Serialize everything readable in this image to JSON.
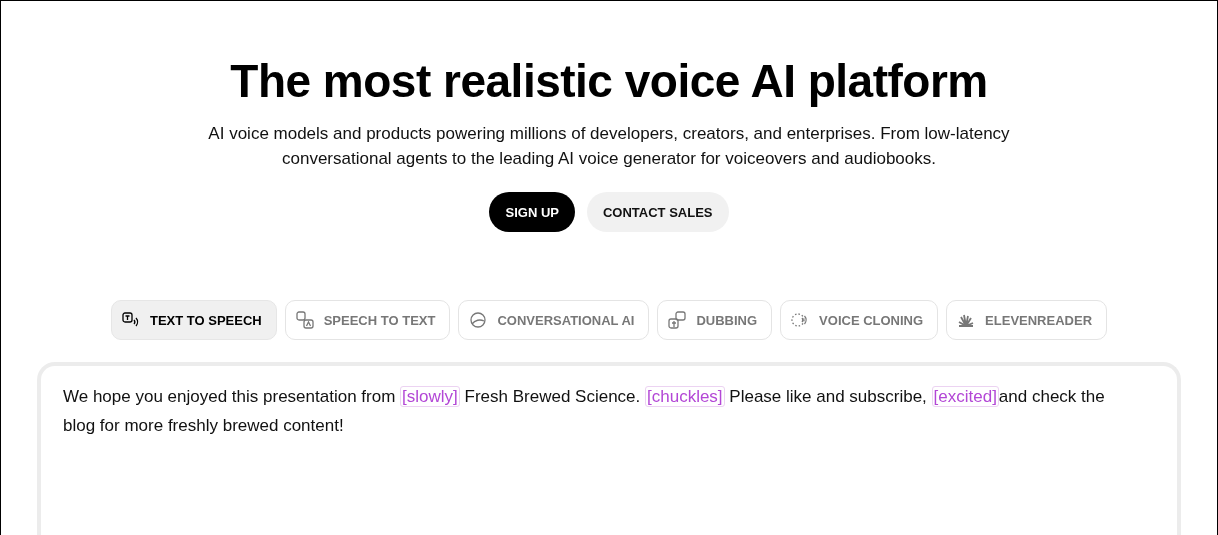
{
  "hero": {
    "title": "The most realistic voice AI platform",
    "subtitle": "AI voice models and products powering millions of developers, creators, and enterprises. From low-latency conversational agents to the leading AI voice generator for voiceovers and audiobooks."
  },
  "buttons": [
    {
      "label": "SIGN UP",
      "kind": "primary"
    },
    {
      "label": "CONTACT SALES",
      "kind": "secondary"
    }
  ],
  "tabs": [
    {
      "label": "TEXT TO SPEECH",
      "kind": "tts",
      "selected": true
    },
    {
      "label": "SPEECH TO TEXT",
      "kind": "stt",
      "selected": false
    },
    {
      "label": "CONVERSATIONAL AI",
      "kind": "chat",
      "selected": false
    },
    {
      "label": "DUBBING",
      "kind": "dub",
      "selected": false
    },
    {
      "label": "VOICE CLONING",
      "kind": "clone",
      "selected": false
    },
    {
      "label": "ELEVENREADER",
      "kind": "reader",
      "selected": false
    }
  ],
  "editor": {
    "segments": [
      {
        "kind": "plain",
        "text": "We hope you enjoyed this presentation from "
      },
      {
        "kind": "tag",
        "text": "[slowly]"
      },
      {
        "kind": "plain",
        "text": " Fresh Brewed Science. "
      },
      {
        "kind": "tag",
        "text": "[chuckles]"
      },
      {
        "kind": "plain",
        "text": " Please like and subscribe, "
      },
      {
        "kind": "tag",
        "text": "[excited]"
      },
      {
        "kind": "plain",
        "text": "and check the blog for more freshly brewed content!"
      }
    ]
  }
}
